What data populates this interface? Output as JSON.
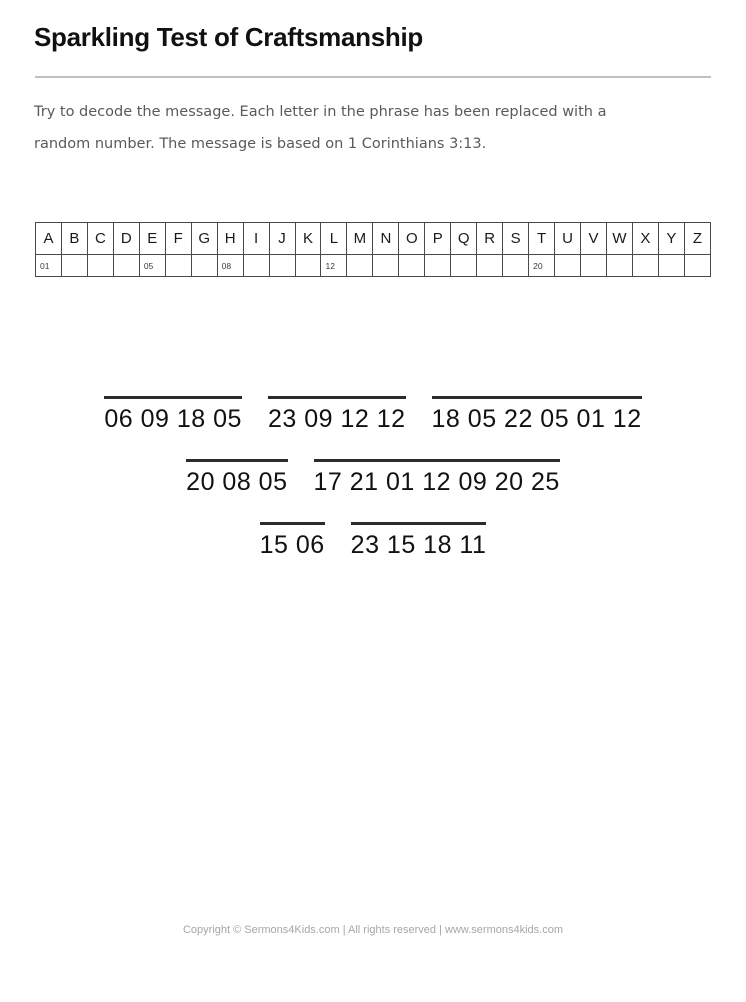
{
  "document": {
    "title": "Sparkling Test of Craftsmanship",
    "instructions": [
      "Try to decode the message. Each letter in the phrase has been replaced with a",
      "random number. The message is based on 1 Corinthians 3:13."
    ]
  },
  "cipher_table": {
    "letters": [
      "A",
      "B",
      "C",
      "D",
      "E",
      "F",
      "G",
      "H",
      "I",
      "J",
      "K",
      "L",
      "M",
      "N",
      "O",
      "P",
      "Q",
      "R",
      "S",
      "T",
      "U",
      "V",
      "W",
      "X",
      "Y",
      "Z"
    ],
    "codes": [
      "01",
      "",
      "",
      "",
      "05",
      "",
      "",
      "08",
      "",
      "",
      "",
      "12",
      "",
      "",
      "",
      "",
      "",
      "",
      "",
      "20",
      "",
      "",
      "",
      "",
      "",
      ""
    ]
  },
  "puzzle": {
    "lines": [
      {
        "words": [
          {
            "codes": "06 09 18 05"
          },
          {
            "codes": "23 09 12 12"
          },
          {
            "codes": "18 05 22 05 01 12"
          }
        ]
      },
      {
        "words": [
          {
            "codes": "20 08 05"
          },
          {
            "codes": "17 21 01 12 09 20 25"
          }
        ]
      },
      {
        "words": [
          {
            "codes": "15 06"
          },
          {
            "codes": "23 15 18 11"
          }
        ]
      }
    ]
  },
  "footer": {
    "text": "Copyright © Sermons4Kids.com | All rights reserved | www.sermons4kids.com"
  }
}
